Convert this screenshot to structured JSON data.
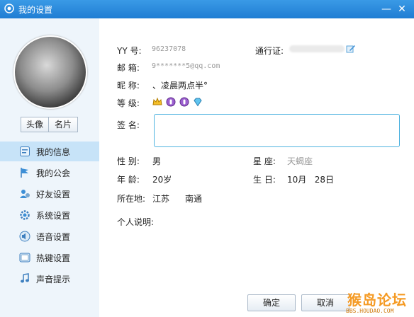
{
  "window": {
    "title": "我的设置",
    "minimize": "—",
    "close": "✕"
  },
  "avatar_buttons": {
    "avatar": "头像",
    "card": "名片"
  },
  "sidebar": {
    "items": [
      {
        "label": "我的信息",
        "icon": "info-card-icon",
        "active": true
      },
      {
        "label": "我的公会",
        "icon": "flag-icon",
        "active": false
      },
      {
        "label": "好友设置",
        "icon": "friends-icon",
        "active": false
      },
      {
        "label": "系统设置",
        "icon": "gear-icon",
        "active": false
      },
      {
        "label": "语音设置",
        "icon": "speaker-icon",
        "active": false
      },
      {
        "label": "热键设置",
        "icon": "hotkey-icon",
        "active": false
      },
      {
        "label": "声音提示",
        "icon": "music-note-icon",
        "active": false
      }
    ]
  },
  "profile": {
    "yy_label": "YY  号:",
    "yy_value": "96237078",
    "pass_label": "通行证:",
    "mail_label": "邮  箱:",
    "mail_value": "9*******5@qq.com",
    "nick_label": "昵  称:",
    "nick_value": "、凌晨两点半°",
    "level_label": "等  级:",
    "sign_label": "签  名:",
    "gender_label": "性  别:",
    "gender_value": "男",
    "star_label": "星  座:",
    "star_value": "天蝎座",
    "age_label": "年  龄:",
    "age_value": "20岁",
    "birth_label": "生  日:",
    "birth_value": "10月   28日",
    "loc_label": "所在地:",
    "loc_province": "江苏",
    "loc_city": "南通",
    "desc_label": "个人说明:"
  },
  "footer": {
    "ok": "确定",
    "cancel": "取消"
  },
  "watermark": {
    "brand": "猴岛论坛",
    "url": "BBS.HOUDAO.COM"
  },
  "colors": {
    "titlebar": "#2a8ce0",
    "sidebar_bg": "#eef5fb",
    "active_item": "#c7e3f8",
    "focus_border": "#4fb3e0",
    "watermark": "#f59a23"
  }
}
